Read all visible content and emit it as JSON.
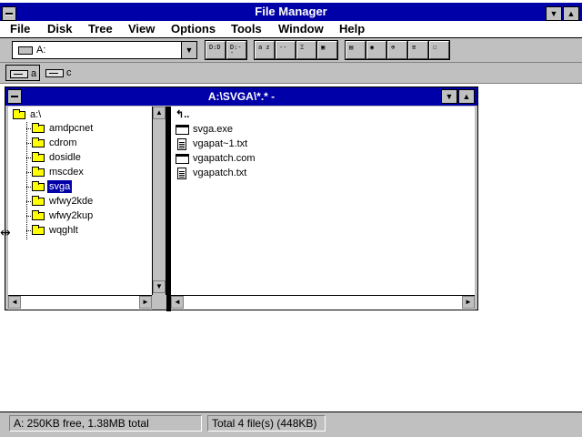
{
  "window": {
    "title": "File Manager",
    "minimize_glyph": "▼",
    "maximize_glyph": "▲"
  },
  "menu": [
    {
      "label": "File"
    },
    {
      "label": "Disk"
    },
    {
      "label": "Tree"
    },
    {
      "label": "View"
    },
    {
      "label": "Options"
    },
    {
      "label": "Tools"
    },
    {
      "label": "Window"
    },
    {
      "label": "Help"
    }
  ],
  "toolbar": {
    "drive_value": "A:",
    "drop_glyph": "▼",
    "buttons": [
      {
        "name": "connect-drive-icon",
        "glyph": "D:D:"
      },
      {
        "name": "disconnect-drive-icon",
        "glyph": "D:--"
      },
      {
        "name": "view-name-icon",
        "glyph": "a z"
      },
      {
        "name": "view-details-icon",
        "glyph": "--"
      },
      {
        "name": "sort-icon",
        "glyph": "Ξ"
      },
      {
        "name": "copy-icon",
        "glyph": "▣"
      },
      {
        "name": "properties-icon",
        "glyph": "▤"
      },
      {
        "name": "network-icon",
        "glyph": "◉"
      },
      {
        "name": "share-icon",
        "glyph": "⊕"
      },
      {
        "name": "stop-sharing-icon",
        "glyph": "≡"
      },
      {
        "name": "printer-icon",
        "glyph": "☐"
      }
    ]
  },
  "drives": [
    {
      "label": "a",
      "selected": true
    },
    {
      "label": "c",
      "selected": false
    }
  ],
  "child_window": {
    "title": "A:\\SVGA\\*.* -",
    "minimize_glyph": "▼",
    "maximize_glyph": "▲"
  },
  "tree": {
    "root": "a:\\",
    "folders": [
      {
        "label": "amdpcnet"
      },
      {
        "label": "cdrom"
      },
      {
        "label": "dosidle"
      },
      {
        "label": "mscdex"
      },
      {
        "label": "svga",
        "selected": true
      },
      {
        "label": "wfwy2kde"
      },
      {
        "label": "wfwy2kup"
      },
      {
        "label": "wqghlt"
      }
    ]
  },
  "files": {
    "up_glyph": "↰..",
    "items": [
      {
        "label": "svga.exe",
        "type": "exe"
      },
      {
        "label": "vgapat~1.txt",
        "type": "doc"
      },
      {
        "label": "vgapatch.com",
        "type": "exe"
      },
      {
        "label": "vgapatch.txt",
        "type": "doc"
      }
    ]
  },
  "scroll": {
    "up": "▲",
    "down": "▼",
    "left": "◄",
    "right": "►"
  },
  "status": {
    "disk": "A: 250KB free,  1.38MB total",
    "files": "Total 4 file(s) (448KB)"
  },
  "cursor_glyph": "⇹"
}
